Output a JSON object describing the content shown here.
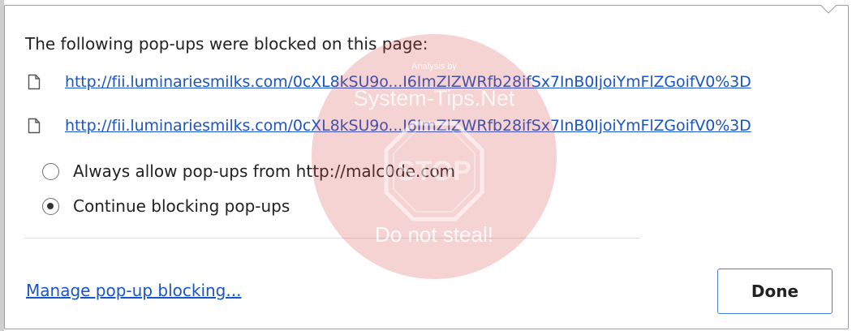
{
  "dialog": {
    "title": "The following pop-ups were blocked on this page:",
    "blocked_popups": [
      {
        "url": "http://fii.luminariesmilks.com/0cXL8kSU9o...I6ImZlZWRfb28ifSx7InB0IjoiYmFlZGoifV0%3D",
        "icon": "document-icon"
      },
      {
        "url": "http://fii.luminariesmilks.com/0cXL8kSU9o...I6ImZlZWRfb28ifSx7InB0IjoiYmFlZGoifV0%3D",
        "icon": "document-icon"
      }
    ],
    "options": [
      {
        "label": "Always allow pop-ups from http://malc0de.com",
        "checked": false
      },
      {
        "label": "Continue blocking pop-ups",
        "checked": true
      }
    ],
    "manage_link": "Manage pop-up blocking...",
    "done_label": "Done"
  },
  "watermark": {
    "top_small": "Analysis by",
    "site": "System-Tips.Net",
    "sign_text": "STOP",
    "bottom": "Do not steal!"
  },
  "colors": {
    "link": "#1a55c8",
    "done_border": "#4a7fd0",
    "watermark": "#d64646"
  }
}
